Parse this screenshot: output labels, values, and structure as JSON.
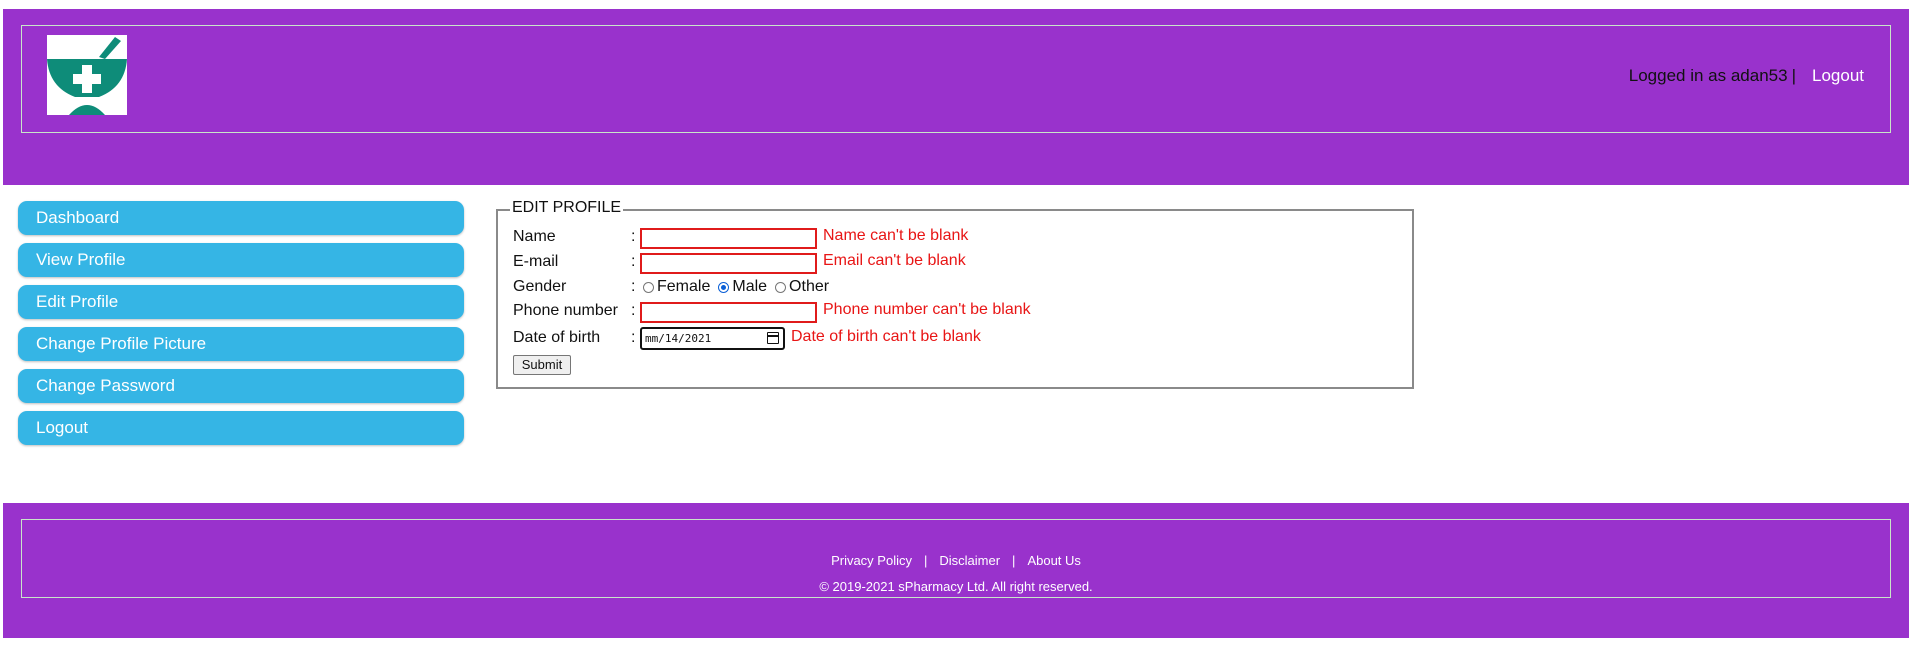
{
  "header": {
    "logged_in_text": "Logged in as adan53",
    "separator": "|",
    "logout_label": "Logout",
    "logo_icon": "pharmacy-mortar-cross-icon"
  },
  "sidebar": {
    "items": [
      {
        "label": "Dashboard"
      },
      {
        "label": "View Profile"
      },
      {
        "label": "Edit Profile"
      },
      {
        "label": "Change Profile Picture"
      },
      {
        "label": "Change Password"
      },
      {
        "label": "Logout"
      }
    ]
  },
  "form": {
    "legend": "EDIT PROFILE",
    "colon": ":",
    "name": {
      "label": "Name",
      "value": "",
      "error": "Name can't be blank"
    },
    "email": {
      "label": "E-mail",
      "value": "",
      "error": "Email can't be blank"
    },
    "gender": {
      "label": "Gender",
      "options": [
        "Female",
        "Male",
        "Other"
      ],
      "selected": "Male"
    },
    "phone": {
      "label": "Phone number",
      "value": "",
      "error": "Phone number can't be blank"
    },
    "dob": {
      "label": "Date of birth",
      "value": "mm/14/2021",
      "error": "Date of birth can't be blank"
    },
    "submit_label": "Submit"
  },
  "footer": {
    "links": [
      "Privacy Policy",
      "Disclaimer",
      "About Us"
    ],
    "link_separator": "|",
    "copyright": "© 2019-2021 sPharmacy Ltd. All right reserved."
  },
  "colors": {
    "brand_purple": "#9932cc",
    "nav_blue": "#35b5e5",
    "error_red": "#e81515",
    "logo_teal": "#0e8c79"
  }
}
